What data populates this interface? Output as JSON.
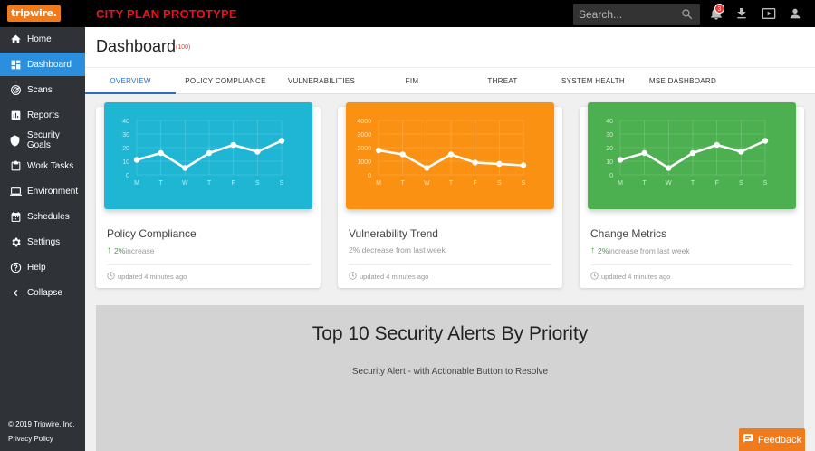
{
  "topbar": {
    "logo": "tripwire.",
    "title": "CITY PLAN PROTOTYPE",
    "search_placeholder": "Search...",
    "notification_count": "3"
  },
  "sidebar": {
    "items": [
      {
        "label": "Home",
        "icon": "home-icon"
      },
      {
        "label": "Dashboard",
        "icon": "dashboard-icon",
        "active": true
      },
      {
        "label": "Scans",
        "icon": "scans-icon"
      },
      {
        "label": "Reports",
        "icon": "reports-icon"
      },
      {
        "label": "Security Goals",
        "icon": "shield-icon"
      },
      {
        "label": "Work Tasks",
        "icon": "clipboard-icon"
      },
      {
        "label": "Environment",
        "icon": "laptop-icon"
      },
      {
        "label": "Schedules",
        "icon": "calendar-icon"
      },
      {
        "label": "Settings",
        "icon": "gear-icon"
      },
      {
        "label": "Help",
        "icon": "help-icon"
      },
      {
        "label": "Collapse",
        "icon": "chevron-left-icon"
      }
    ],
    "copyright": "© 2019 Tripwire, Inc.",
    "privacy": "Privacy Policy"
  },
  "header": {
    "title": "Dashboard",
    "count": "(100)"
  },
  "tabs": [
    {
      "label": "OVERVIEW",
      "active": true
    },
    {
      "label": "POLICY COMPLIANCE"
    },
    {
      "label": "VULNERABILITIES"
    },
    {
      "label": "FIM"
    },
    {
      "label": "THREAT"
    },
    {
      "label": "SYSTEM HEALTH"
    },
    {
      "label": "MSE DASHBOARD"
    }
  ],
  "cards": [
    {
      "title": "Policy Compliance",
      "sub_value": "2%",
      "sub_text": " increase",
      "sub_arrow": true,
      "footer": "updated 4 minutes ago",
      "color": "#1eb6d3"
    },
    {
      "title": "Vulnerability Trend",
      "sub_value": "",
      "sub_text": "2% decrease from last week",
      "sub_arrow": false,
      "footer": "updated 4 minutes ago",
      "color": "#fb9113"
    },
    {
      "title": "Change Metrics",
      "sub_value": "2%",
      "sub_text": " increase from last week",
      "sub_arrow": true,
      "footer": "updated 4 minutes ago",
      "color": "#4caf50"
    }
  ],
  "chart_data": [
    {
      "type": "line",
      "categories": [
        "M",
        "T",
        "W",
        "T",
        "F",
        "S",
        "S"
      ],
      "values": [
        11,
        16,
        5,
        16,
        22,
        17,
        25
      ],
      "yticks": [
        "0",
        "10",
        "20",
        "30",
        "40"
      ],
      "ylim": [
        0,
        40
      ]
    },
    {
      "type": "line",
      "categories": [
        "M",
        "T",
        "W",
        "T",
        "F",
        "S",
        "S"
      ],
      "values": [
        1800,
        1500,
        500,
        1500,
        900,
        800,
        700
      ],
      "yticks": [
        "0",
        "1000",
        "2000",
        "3000",
        "4000"
      ],
      "ylim": [
        0,
        4000
      ]
    },
    {
      "type": "line",
      "categories": [
        "M",
        "T",
        "W",
        "T",
        "F",
        "S",
        "S"
      ],
      "values": [
        11,
        16,
        5,
        16,
        22,
        17,
        25
      ],
      "yticks": [
        "0",
        "10",
        "20",
        "30",
        "40"
      ],
      "ylim": [
        0,
        40
      ]
    }
  ],
  "alerts": {
    "title": "Top 10 Security Alerts By Priority",
    "subtitle": "Security Alert - with Actionable Button to Resolve"
  },
  "feedback": {
    "label": "Feedback"
  }
}
